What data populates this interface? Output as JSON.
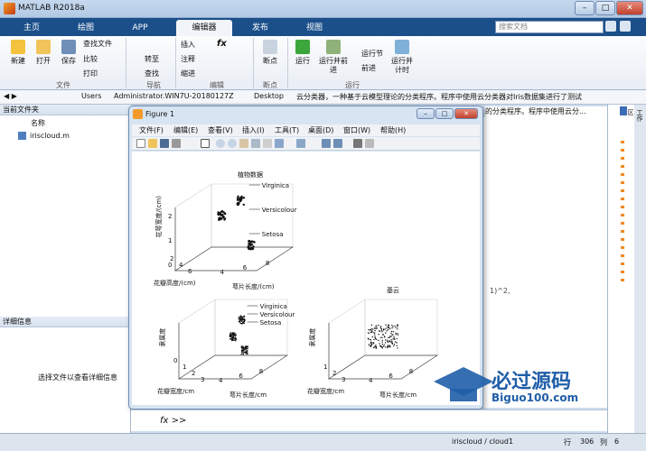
{
  "app": {
    "title": "MATLAB R2018a"
  },
  "tabs": [
    "主页",
    "绘图",
    "APP",
    "编辑器",
    "发布",
    "视图"
  ],
  "active_tab": "编辑器",
  "search_placeholder": "搜索文档",
  "ribbon": {
    "file": {
      "new": "新建",
      "open": "打开",
      "save": "保存",
      "find_files": "查找文件",
      "compare": "比较",
      "print": "打印",
      "group": "文件"
    },
    "navigate": {
      "goto": "转至",
      "find": "查找",
      "group": "导航"
    },
    "edit": {
      "insert": "插入",
      "fx": "fx",
      "comment": "注释",
      "indent": "缩进",
      "group": "编辑"
    },
    "breakpoints": {
      "label": "断点",
      "group": "断点"
    },
    "run": {
      "run": "运行",
      "run_advance": "运行并前进",
      "run_section": "运行节",
      "advance": "前进",
      "run_time": "运行并计时",
      "group": "运行"
    }
  },
  "address": {
    "parts": [
      "Users",
      "Administrator.WIN7U-20180127Z",
      "Desktop",
      "云分类器，一种基于云模型理论的分类程序。程序中使用云分类器对Iris数据集进行了测试"
    ]
  },
  "left_panel": {
    "title": "当前文件夹",
    "col": "名称",
    "file": "iriscloud.m",
    "details_title": "详细信息",
    "details_hint": "选择文件以查看详细信息"
  },
  "right_panel": {
    "title": "工作区",
    "bg_text": "的分类程序。程序中使用云分..."
  },
  "figure": {
    "title": "Figure 1",
    "menu": [
      "文件(F)",
      "编辑(E)",
      "查看(V)",
      "插入(I)",
      "工具(T)",
      "桌面(D)",
      "窗口(W)",
      "帮助(H)"
    ]
  },
  "chart_data": [
    {
      "type": "scatter",
      "title": "植物数据",
      "xlabel": "萼片长度/(cm)",
      "ylabel": "花瓣高度/(cm)",
      "zlabel": "花萼宽度/(cm)",
      "xticks": [
        "4",
        "6",
        "8"
      ],
      "yticks": [
        "2",
        "4",
        "6"
      ],
      "zticks": [
        "0",
        "1",
        "2"
      ],
      "annotations": [
        "Virginica",
        "Versicolour",
        "Setosa"
      ]
    },
    {
      "type": "scatter",
      "title": "",
      "xlabel": "萼片长度/cm",
      "ylabel": "花瓣宽度/cm",
      "zlabel": "隶属度",
      "xticks": [
        "4",
        "6",
        "8"
      ],
      "yticks": [
        "0",
        "1",
        "2",
        "3"
      ],
      "zticks": [],
      "annotations": [
        "Virginica",
        "Versicolour",
        "Setosa"
      ]
    },
    {
      "type": "scatter",
      "title": "基云",
      "xlabel": "萼片长度/cm",
      "ylabel": "花瓣宽度/cm",
      "zlabel": "隶属度",
      "xticks": [
        "4",
        "6",
        "8"
      ],
      "yticks": [
        "1",
        "2",
        "3"
      ],
      "zticks": [],
      "annotations": []
    }
  ],
  "code_fragment": "1)^2,",
  "command_prompt": "fx >>",
  "status": {
    "file": "iriscloud / cloud1",
    "row_label": "行",
    "row": "306",
    "col_label": "列",
    "col": "6"
  },
  "watermark": {
    "main": "必过源码",
    "sub": "Biguo100.com"
  }
}
